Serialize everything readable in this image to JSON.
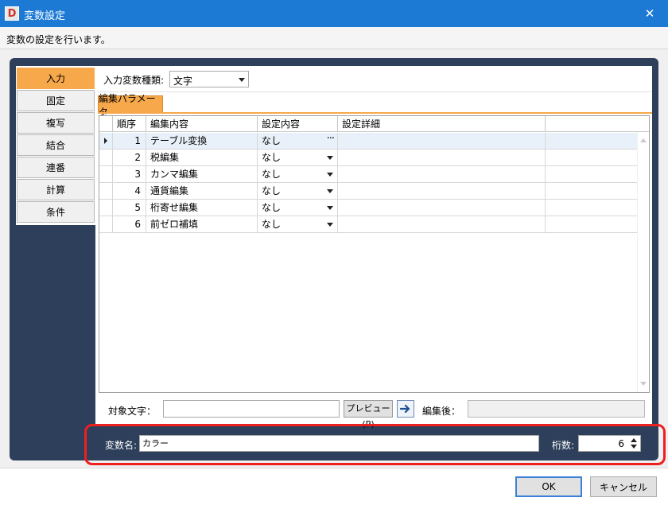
{
  "window": {
    "title": "変数設定",
    "icon_letter": "D",
    "close_glyph": "✕",
    "description": "変数の設定を行います。"
  },
  "tabs": [
    {
      "label": "入力",
      "active": true
    },
    {
      "label": "固定",
      "active": false
    },
    {
      "label": "複写",
      "active": false
    },
    {
      "label": "結合",
      "active": false
    },
    {
      "label": "連番",
      "active": false
    },
    {
      "label": "計算",
      "active": false
    },
    {
      "label": "条件",
      "active": false
    }
  ],
  "input_type": {
    "label": "入力変数種類:",
    "value": "文字"
  },
  "edit_tab": {
    "label": "編集パラメータ"
  },
  "grid": {
    "columns": [
      "順序",
      "編集内容",
      "設定内容",
      "設定詳細"
    ],
    "rows": [
      {
        "order": "1",
        "content": "テーブル変換",
        "setting": "なし",
        "detail": "",
        "control": "ellipsis"
      },
      {
        "order": "2",
        "content": "税編集",
        "setting": "なし",
        "detail": "",
        "control": "dropdown"
      },
      {
        "order": "3",
        "content": "カンマ編集",
        "setting": "なし",
        "detail": "",
        "control": "dropdown"
      },
      {
        "order": "4",
        "content": "通貨編集",
        "setting": "なし",
        "detail": "",
        "control": "dropdown"
      },
      {
        "order": "5",
        "content": "桁寄せ編集",
        "setting": "なし",
        "detail": "",
        "control": "dropdown"
      },
      {
        "order": "6",
        "content": "前ゼロ補填",
        "setting": "なし",
        "detail": "",
        "control": "dropdown"
      }
    ],
    "ellipsis_glyph": "···"
  },
  "preview": {
    "target_label": "対象文字：",
    "target_value": "",
    "button_label": "プレビュー(P)",
    "after_label": "編集後：",
    "after_value": ""
  },
  "variable": {
    "name_label": "変数名:",
    "name_value": "カラー",
    "digits_label": "桁数:",
    "digits_value": "6"
  },
  "buttons": {
    "ok": "OK",
    "cancel": "キャンセル"
  },
  "colors": {
    "titlebar": "#1c7ad4",
    "panel": "#2d3f5a",
    "active_tab": "#f7a84a",
    "highlight": "#ee1f1f"
  }
}
